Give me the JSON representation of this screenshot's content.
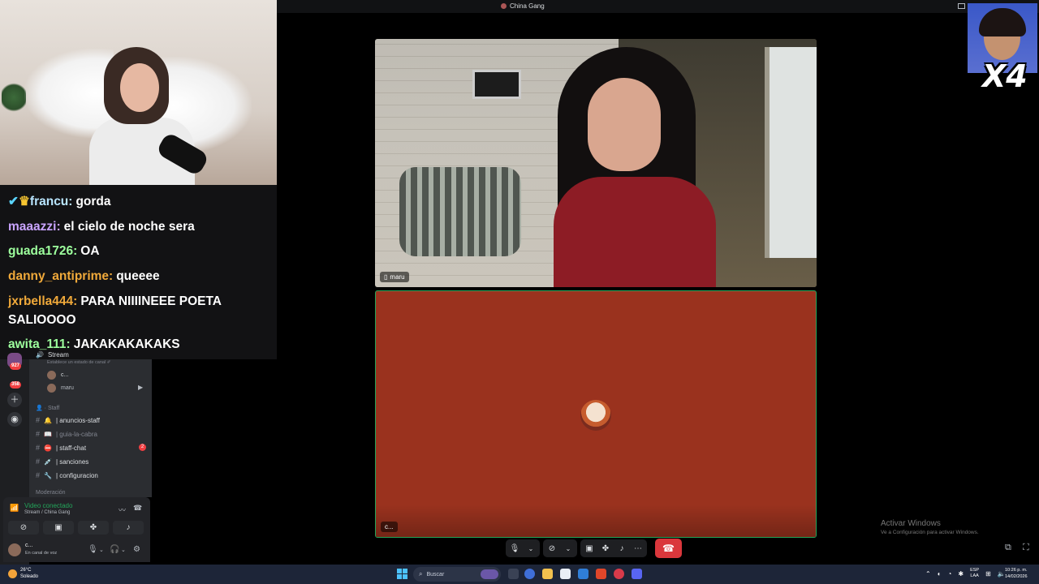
{
  "window": {
    "title": "China Gang"
  },
  "chat": [
    {
      "user": "francu:",
      "text": "gorda",
      "color": "#b9e5ff",
      "badges": "crown"
    },
    {
      "user": "maaazzi:",
      "text": "el cielo de noche sera",
      "color": "#c9a4ff"
    },
    {
      "user": "guada1726:",
      "text": "OA",
      "color": "#9dff9d"
    },
    {
      "user": "danny_antiprime:",
      "text": "queeee",
      "color": "#f0a93a"
    },
    {
      "user": "jxrbella444:",
      "text": "PARA NIIIINEEE POETA SALIOOOO",
      "color": "#f0a93a"
    },
    {
      "user": "awita_111:",
      "text": "JAKAKAKAKAKS",
      "color": "#9dff9d"
    }
  ],
  "sidebar": {
    "rail_badges": [
      "927",
      "358"
    ],
    "stream_channel": "Stream",
    "status_hint": "Establece un estado de canal ✐",
    "voice_users": [
      "c...",
      "maru"
    ],
    "category_staff": "Staff",
    "channels": [
      {
        "name": "| anuncios-staff",
        "icon": "bell"
      },
      {
        "name": "| guia-la-cabra",
        "icon": "book",
        "muted": true
      },
      {
        "name": "| staff-chat",
        "icon": "no-entry",
        "badge": "2"
      },
      {
        "name": "| sanciones",
        "icon": "syringe"
      },
      {
        "name": "| configuracion",
        "icon": "wrench"
      }
    ],
    "category_mod": "Moderación"
  },
  "voice_panel": {
    "status": "Video conectado",
    "location": "Stream / China Gang"
  },
  "user_panel": {
    "name": "c...",
    "status": "En canal de voz"
  },
  "video": {
    "top_name": "maru",
    "bottom_name": "c..."
  },
  "overlay": {
    "multiplier": "X4"
  },
  "watermark": {
    "line1": "Activar Windows",
    "line2": "Ve a Configuración para activar Windows."
  },
  "taskbar": {
    "temp": "26°C",
    "weather": "Soleado",
    "search_placeholder": "Buscar",
    "lang_top": "ESP",
    "lang_bottom": "LAA",
    "time": "10:26 p. m.",
    "date": "14/02/2026"
  }
}
